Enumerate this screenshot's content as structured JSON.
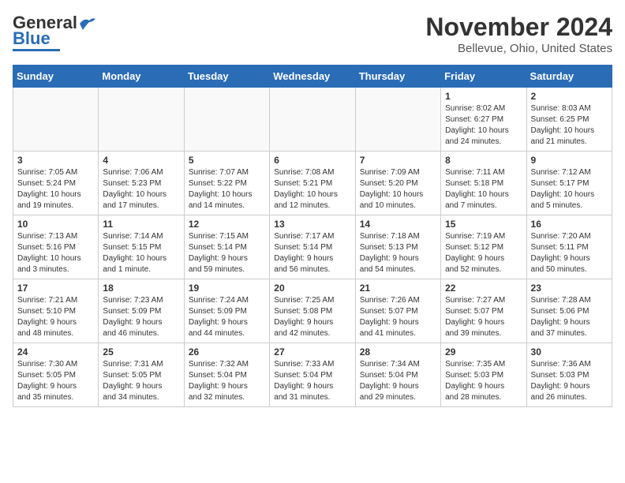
{
  "header": {
    "logo_general": "General",
    "logo_blue": "Blue",
    "month_title": "November 2024",
    "location": "Bellevue, Ohio, United States"
  },
  "weekdays": [
    "Sunday",
    "Monday",
    "Tuesday",
    "Wednesday",
    "Thursday",
    "Friday",
    "Saturday"
  ],
  "weeks": [
    [
      {
        "day": "",
        "info": ""
      },
      {
        "day": "",
        "info": ""
      },
      {
        "day": "",
        "info": ""
      },
      {
        "day": "",
        "info": ""
      },
      {
        "day": "",
        "info": ""
      },
      {
        "day": "1",
        "info": "Sunrise: 8:02 AM\nSunset: 6:27 PM\nDaylight: 10 hours\nand 24 minutes."
      },
      {
        "day": "2",
        "info": "Sunrise: 8:03 AM\nSunset: 6:25 PM\nDaylight: 10 hours\nand 21 minutes."
      }
    ],
    [
      {
        "day": "3",
        "info": "Sunrise: 7:05 AM\nSunset: 5:24 PM\nDaylight: 10 hours\nand 19 minutes."
      },
      {
        "day": "4",
        "info": "Sunrise: 7:06 AM\nSunset: 5:23 PM\nDaylight: 10 hours\nand 17 minutes."
      },
      {
        "day": "5",
        "info": "Sunrise: 7:07 AM\nSunset: 5:22 PM\nDaylight: 10 hours\nand 14 minutes."
      },
      {
        "day": "6",
        "info": "Sunrise: 7:08 AM\nSunset: 5:21 PM\nDaylight: 10 hours\nand 12 minutes."
      },
      {
        "day": "7",
        "info": "Sunrise: 7:09 AM\nSunset: 5:20 PM\nDaylight: 10 hours\nand 10 minutes."
      },
      {
        "day": "8",
        "info": "Sunrise: 7:11 AM\nSunset: 5:18 PM\nDaylight: 10 hours\nand 7 minutes."
      },
      {
        "day": "9",
        "info": "Sunrise: 7:12 AM\nSunset: 5:17 PM\nDaylight: 10 hours\nand 5 minutes."
      }
    ],
    [
      {
        "day": "10",
        "info": "Sunrise: 7:13 AM\nSunset: 5:16 PM\nDaylight: 10 hours\nand 3 minutes."
      },
      {
        "day": "11",
        "info": "Sunrise: 7:14 AM\nSunset: 5:15 PM\nDaylight: 10 hours\nand 1 minute."
      },
      {
        "day": "12",
        "info": "Sunrise: 7:15 AM\nSunset: 5:14 PM\nDaylight: 9 hours\nand 59 minutes."
      },
      {
        "day": "13",
        "info": "Sunrise: 7:17 AM\nSunset: 5:14 PM\nDaylight: 9 hours\nand 56 minutes."
      },
      {
        "day": "14",
        "info": "Sunrise: 7:18 AM\nSunset: 5:13 PM\nDaylight: 9 hours\nand 54 minutes."
      },
      {
        "day": "15",
        "info": "Sunrise: 7:19 AM\nSunset: 5:12 PM\nDaylight: 9 hours\nand 52 minutes."
      },
      {
        "day": "16",
        "info": "Sunrise: 7:20 AM\nSunset: 5:11 PM\nDaylight: 9 hours\nand 50 minutes."
      }
    ],
    [
      {
        "day": "17",
        "info": "Sunrise: 7:21 AM\nSunset: 5:10 PM\nDaylight: 9 hours\nand 48 minutes."
      },
      {
        "day": "18",
        "info": "Sunrise: 7:23 AM\nSunset: 5:09 PM\nDaylight: 9 hours\nand 46 minutes."
      },
      {
        "day": "19",
        "info": "Sunrise: 7:24 AM\nSunset: 5:09 PM\nDaylight: 9 hours\nand 44 minutes."
      },
      {
        "day": "20",
        "info": "Sunrise: 7:25 AM\nSunset: 5:08 PM\nDaylight: 9 hours\nand 42 minutes."
      },
      {
        "day": "21",
        "info": "Sunrise: 7:26 AM\nSunset: 5:07 PM\nDaylight: 9 hours\nand 41 minutes."
      },
      {
        "day": "22",
        "info": "Sunrise: 7:27 AM\nSunset: 5:07 PM\nDaylight: 9 hours\nand 39 minutes."
      },
      {
        "day": "23",
        "info": "Sunrise: 7:28 AM\nSunset: 5:06 PM\nDaylight: 9 hours\nand 37 minutes."
      }
    ],
    [
      {
        "day": "24",
        "info": "Sunrise: 7:30 AM\nSunset: 5:05 PM\nDaylight: 9 hours\nand 35 minutes."
      },
      {
        "day": "25",
        "info": "Sunrise: 7:31 AM\nSunset: 5:05 PM\nDaylight: 9 hours\nand 34 minutes."
      },
      {
        "day": "26",
        "info": "Sunrise: 7:32 AM\nSunset: 5:04 PM\nDaylight: 9 hours\nand 32 minutes."
      },
      {
        "day": "27",
        "info": "Sunrise: 7:33 AM\nSunset: 5:04 PM\nDaylight: 9 hours\nand 31 minutes."
      },
      {
        "day": "28",
        "info": "Sunrise: 7:34 AM\nSunset: 5:04 PM\nDaylight: 9 hours\nand 29 minutes."
      },
      {
        "day": "29",
        "info": "Sunrise: 7:35 AM\nSunset: 5:03 PM\nDaylight: 9 hours\nand 28 minutes."
      },
      {
        "day": "30",
        "info": "Sunrise: 7:36 AM\nSunset: 5:03 PM\nDaylight: 9 hours\nand 26 minutes."
      }
    ]
  ]
}
